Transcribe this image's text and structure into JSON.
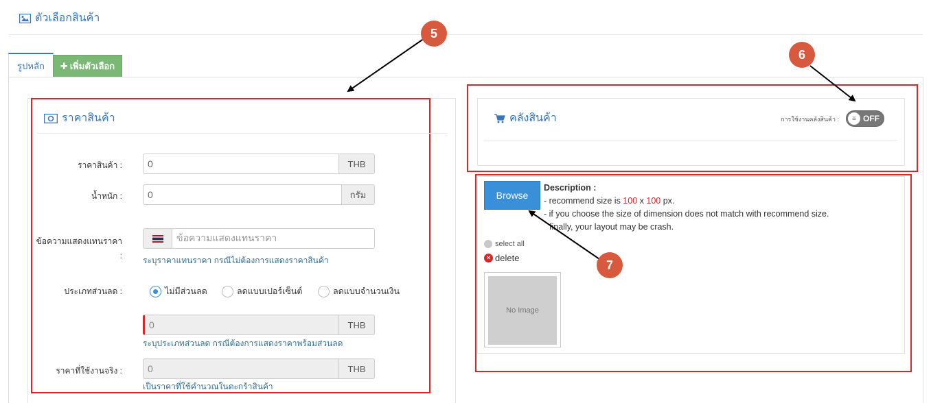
{
  "page": {
    "section_title": "ตัวเลือกสินค้า"
  },
  "tabs": {
    "main_label": "รูปหลัก",
    "add_label": "เพิ่มตัวเลือก"
  },
  "price_panel": {
    "title": "ราคาสินค้า",
    "price_label": "ราคาสินค้า :",
    "price_value": "0",
    "price_unit": "THB",
    "weight_label": "น้ำหนัก :",
    "weight_value": "0",
    "weight_unit": "กรัม",
    "alt_text_label_line1": "ข้อความแสดงแทนราคา",
    "alt_text_label_line2": ":",
    "alt_text_placeholder": "ข้อความแสดงแทนราคา",
    "alt_text_help": "ระบุราคาแทนราคา กรณีไม่ต้องการแสดงราคาสินค้า",
    "discount_label": "ประเภทส่วนลด :",
    "discount_options": [
      "ไม่มีส่วนลด",
      "ลดแบบเปอร์เซ็นต์",
      "ลดแบบจำนวนเงิน"
    ],
    "discount_selected": "ไม่มีส่วนลด",
    "discount_value": "0",
    "discount_unit": "THB",
    "discount_help": "ระบุประเภทส่วนลด กรณีต้องการแสดงราคาพร้อมส่วนลด",
    "actual_label": "ราคาที่ใช้งานจริง :",
    "actual_value": "0",
    "actual_unit": "THB",
    "actual_help": "เป็นราคาที่ใช้คำนวณในตะกร้าสินค้า"
  },
  "stock_panel": {
    "title": "คลังสินค้า",
    "toggle_label": "การใช้งานคลังสินค้า :",
    "toggle_state": "OFF"
  },
  "image_panel": {
    "browse_label": "Browse",
    "desc_title": "Description :",
    "desc_line1_prefix": "- recommend size is ",
    "desc_width": "100",
    "desc_x": " x ",
    "desc_height": "100",
    "desc_line1_suffix": " px.",
    "desc_line2": "- if you choose the size of dimension does not match with recommend size.",
    "desc_line3": "finally, your layout may be crash.",
    "select_all": "select all",
    "delete": "delete",
    "no_image": "No Image",
    "highlight_color": "#d9262a"
  },
  "annotations": {
    "marker_5": "5",
    "marker_6": "6",
    "marker_7": "7",
    "marker_color": "#d85a3e"
  }
}
